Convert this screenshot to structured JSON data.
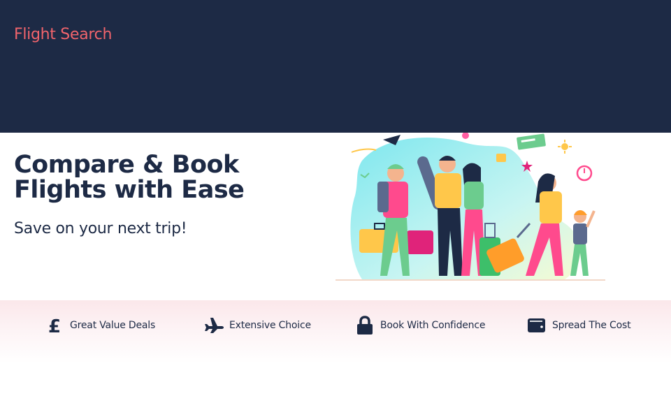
{
  "header": {
    "brand": "Flight Search",
    "bg_color": "#1d2a45",
    "brand_color": "#f1646c"
  },
  "hero": {
    "title": "Compare & Book Flights with Ease",
    "subtitle": "Save on your next trip!",
    "illustration_icon": "family-travelers-illustration"
  },
  "features": [
    {
      "label": "Great Value Deals",
      "icon": "pound-sign-icon"
    },
    {
      "label": "Extensive Choice",
      "icon": "plane-icon"
    },
    {
      "label": "Book With Confidence",
      "icon": "lock-icon"
    },
    {
      "label": "Spread The Cost",
      "icon": "wallet-icon"
    }
  ]
}
